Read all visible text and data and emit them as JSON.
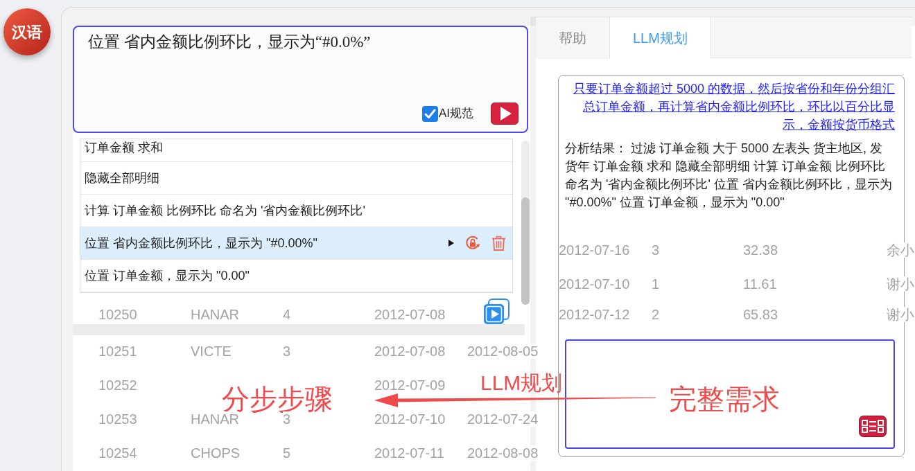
{
  "language_badge": {
    "label": "汉语"
  },
  "input_box": {
    "value": "位置 省内金额比例环比，显示为“#0.0%”",
    "ai_standard": {
      "label": "AI规范",
      "checked": true
    }
  },
  "steps": [
    {
      "text": "订单金额 求和",
      "selected": false
    },
    {
      "text": "隐藏全部明细",
      "selected": false
    },
    {
      "text": "计算 订单金额 比例环比 命名为 '省内金额比例环比'",
      "selected": false
    },
    {
      "text": "位置 省内金额比例环比，显示为 \"#0.00%\"",
      "selected": true
    },
    {
      "text": "位置 订单金额，显示为 \"0.00\"",
      "selected": false
    }
  ],
  "right_panel": {
    "tabs": [
      {
        "label": "帮助",
        "selected": false
      },
      {
        "label": "LLM规划",
        "selected": true
      }
    ],
    "requirement_link": "只要订单金额超过 5000 的数据，然后按省份和年份分组汇总订单金额，再计算省内金额比例环比，环比以百分比显示，金额按货币格式",
    "analysis": "分析结果： 过滤 订单金额 大于 5000 左表头 货主地区, 发货年 订单金额 求和 隐藏全部明细 计算 订单金额 比例环比命名为 '省内金额比例环比' 位置 省内金额比例环比，显示为 \"#0.00%\" 位置 订单金额，显示为 \"0.00\""
  },
  "annotations": {
    "steps_label": "分步步骤",
    "arrow_label": "LLM规划",
    "requirement_label": "完整需求"
  },
  "background_table": {
    "rows": [
      {
        "column_6": "2012-07-16",
        "column_7": "3",
        "column_8": "32.38",
        "column_9": "余小"
      },
      {
        "column_6": "2012-07-10",
        "column_7": "1",
        "column_8": "11.61",
        "column_9": "谢小"
      },
      {
        "column_1": "10250",
        "column_2": "HANAR",
        "column_3": "4",
        "column_4": "2012-07-08",
        "column_6": "2012-07-12",
        "column_7": "2",
        "column_8": "65.83",
        "column_9": "谢小"
      },
      {
        "column_1": "10251",
        "column_2": "VICTE",
        "column_3": "3",
        "column_4": "2012-07-08",
        "column_5": "2012-08-05"
      },
      {
        "column_1": "10252",
        "column_4": "2012-07-09"
      },
      {
        "column_1": "10253",
        "column_2": "HANAR",
        "column_3": "3",
        "column_4": "2012-07-10",
        "column_5": "2012-07-24"
      },
      {
        "column_1": "10254",
        "column_2": "CHOPS",
        "column_3": "5",
        "column_4": "2012-07-11",
        "column_5": "2012-08-08"
      }
    ]
  }
}
